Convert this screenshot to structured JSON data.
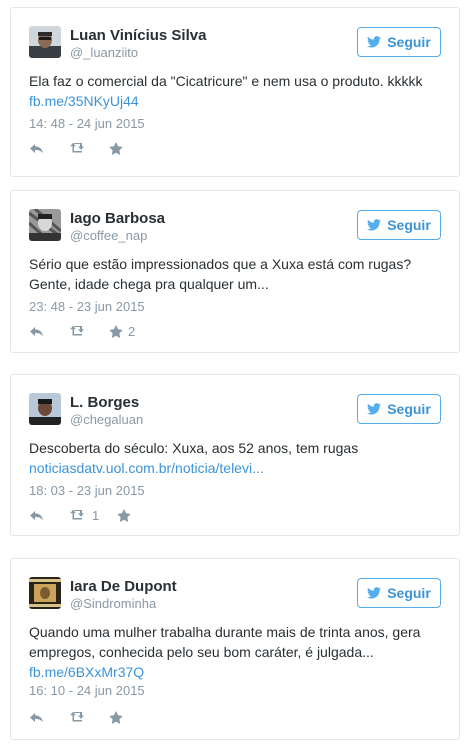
{
  "follow_label": "Seguir",
  "accent_color": "#3b94d9",
  "tweets": [
    {
      "name": "Luan Vinícius Silva",
      "handle": "@_luanziito",
      "text": "Ela faz o comercial da \"Cicatricure\" e nem usa o produto. kkkkk",
      "link": "fb.me/35NKyUj44",
      "time": "14: 48 - 24 jun 2015",
      "retweets": "",
      "likes": ""
    },
    {
      "name": "Iago Barbosa",
      "handle": "@coffee_nap",
      "text": "Sério que estão impressionados que a Xuxa está com rugas? Gente, idade chega pra qualquer um...",
      "link": "",
      "time": "23: 48 - 23 jun 2015",
      "retweets": "",
      "likes": "2"
    },
    {
      "name": "L. Borges",
      "handle": "@chegaluan",
      "text": "Descoberta do século: Xuxa, aos 52 anos, tem rugas",
      "link": "noticiasdatv.uol.com.br/noticia/televi...",
      "time": "18: 03 - 23 jun 2015",
      "retweets": "1",
      "likes": ""
    },
    {
      "name": "Iara De Dupont",
      "handle": "@Sindrominha",
      "text": "Quando uma mulher trabalha durante mais de trinta anos, gera empregos, conhecida pelo seu bom caráter, é julgada...",
      "link": "fb.me/6BXxMr37Q",
      "time": "16: 10 - 24 jun 2015",
      "retweets": "",
      "likes": ""
    }
  ]
}
